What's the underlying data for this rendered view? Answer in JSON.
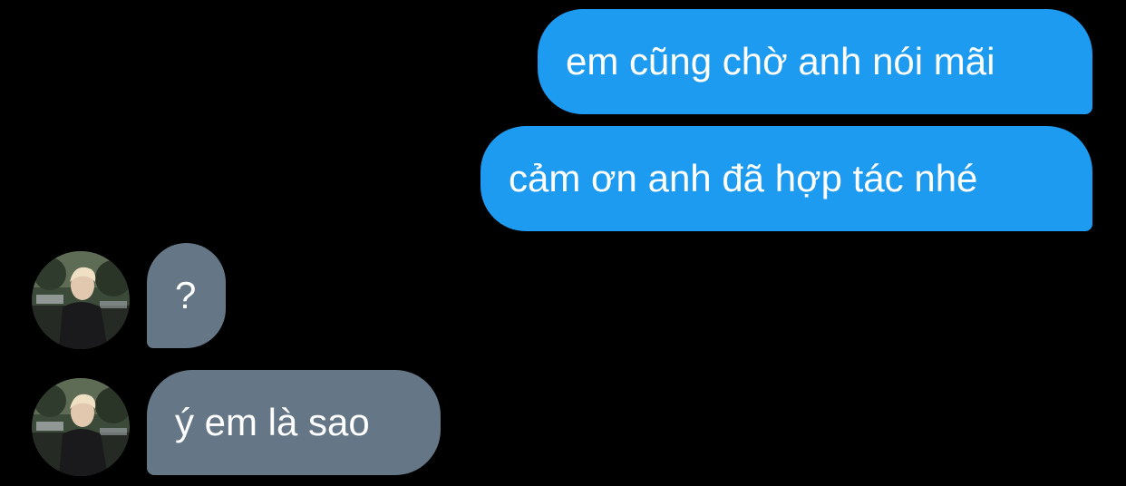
{
  "colors": {
    "background": "#000000",
    "sent_bubble": "#1d9bf0",
    "received_bubble": "#657786",
    "text": "#ffffff"
  },
  "messages": [
    {
      "direction": "sent",
      "text": "em cũng chờ anh nói mãi"
    },
    {
      "direction": "sent",
      "text": "cảm ơn anh đã hợp tác nhé"
    },
    {
      "direction": "received",
      "text": "?",
      "avatar": "contact-avatar"
    },
    {
      "direction": "received",
      "text": "ý em là sao",
      "avatar": "contact-avatar"
    }
  ]
}
